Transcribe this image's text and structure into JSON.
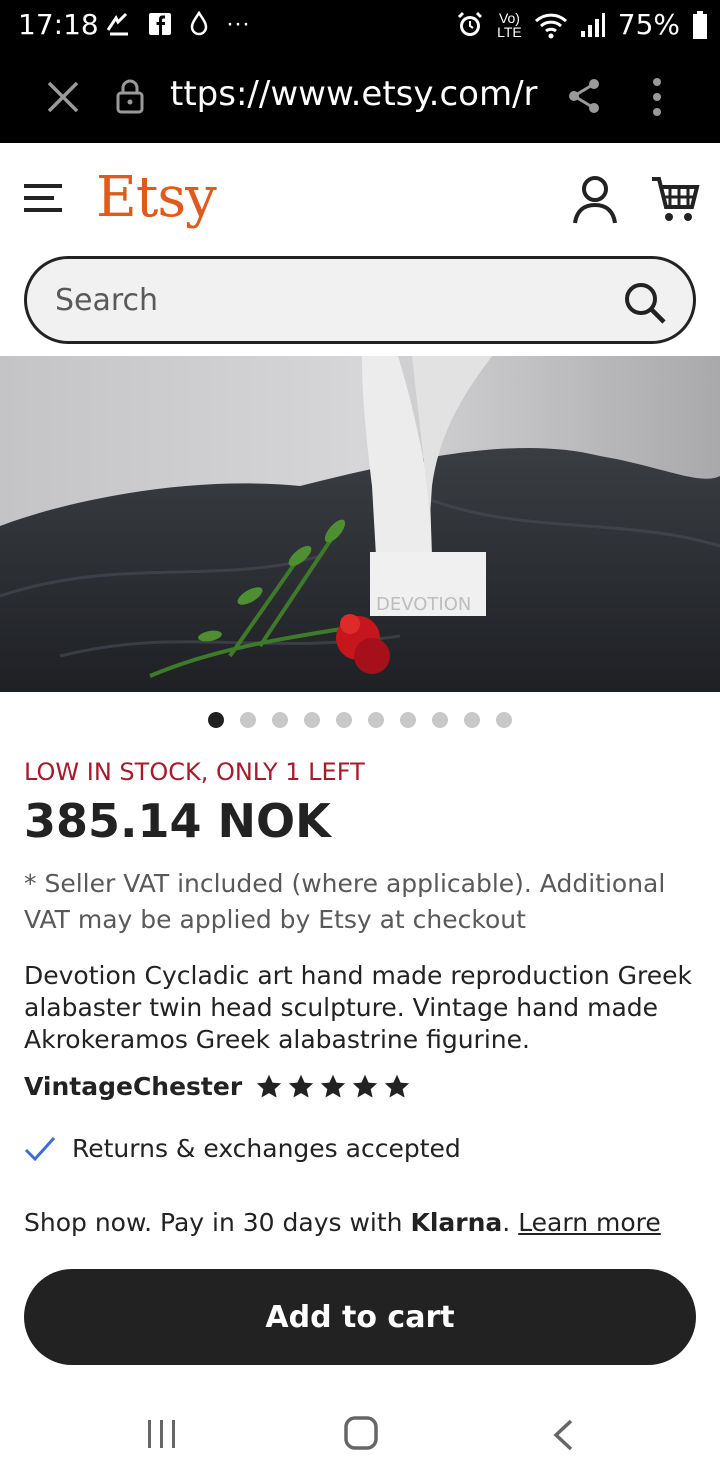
{
  "status_bar": {
    "time": "17:18",
    "more": "···",
    "network": "LTE",
    "battery": "75%"
  },
  "browser": {
    "url": "ttps://www.etsy.com/r"
  },
  "header": {
    "logo": "Etsy"
  },
  "search": {
    "placeholder": "Search"
  },
  "product_image": {
    "label_text": "DEVOTION"
  },
  "carousel": {
    "total": 10,
    "active": 1
  },
  "product": {
    "stock_notice": "LOW IN STOCK, ONLY 1 LEFT",
    "price": "385.14 NOK",
    "vat_note": "* Seller VAT included (where applicable). Additional VAT may be applied by Etsy at checkout",
    "title": "Devotion Cycladic art hand made reproduction Greek alabaster twin head sculpture. Vintage hand made Akrokeramos Greek alabastrine figurine.",
    "shop_name": "VintageChester",
    "rating_stars": 5,
    "returns": "Returns & exchanges accepted",
    "klarna_prefix": "Shop now. Pay in 30 days with ",
    "klarna_brand": "Klarna",
    "klarna_sep": ". ",
    "learn_more": "Learn more",
    "add_to_cart": "Add to cart"
  },
  "colors": {
    "brand": "#e05a1c",
    "stock": "#a61a2e",
    "button": "#222222",
    "check": "#3b6fd6"
  }
}
